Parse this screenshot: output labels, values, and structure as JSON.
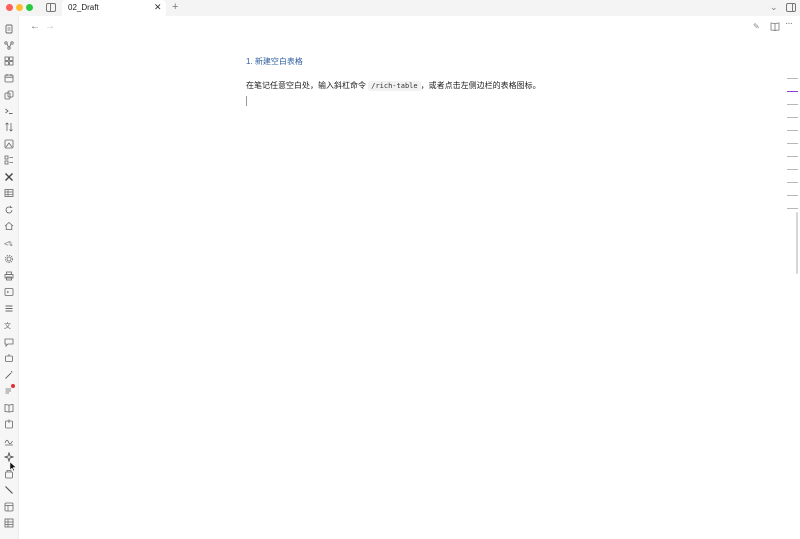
{
  "window": {
    "tab_title": "02_Draft",
    "tab_close": "✕",
    "new_tab": "+",
    "tabs_chevron": "⌄"
  },
  "header": {
    "back": "←",
    "forward": "→",
    "more": "···"
  },
  "document": {
    "heading": "1. 新建空白表格",
    "paragraph_before": "在笔记任意空白处，输入斜杠命令 ",
    "inline_code": "/rich-table",
    "paragraph_after": "，或者点击左侧边栏的表格图标。"
  },
  "ribbon": {
    "icons": [
      "file-icon",
      "graph-icon",
      "grid-icon",
      "calendar-icon",
      "copy-icon",
      "terminal-icon",
      "sort-icon",
      "image-icon",
      "checklist-icon",
      "tools-icon",
      "table-view-icon",
      "refresh-icon",
      "home-icon",
      "code-icon",
      "gear-icon",
      "print-icon",
      "frame-icon",
      "bookmark-icon",
      "translate-icon",
      "chat-icon",
      "robot-icon",
      "wand-icon",
      "notifications-icon",
      "book-icon",
      "export-icon",
      "signature-icon",
      "plugin-icon",
      "sync-icon",
      "pen-icon",
      "template-icon",
      "rich-table-icon"
    ]
  },
  "colors": {
    "heading": "#2f5f9e",
    "outline_active": "#8b3fd6",
    "notification_dot": "#e03131"
  }
}
